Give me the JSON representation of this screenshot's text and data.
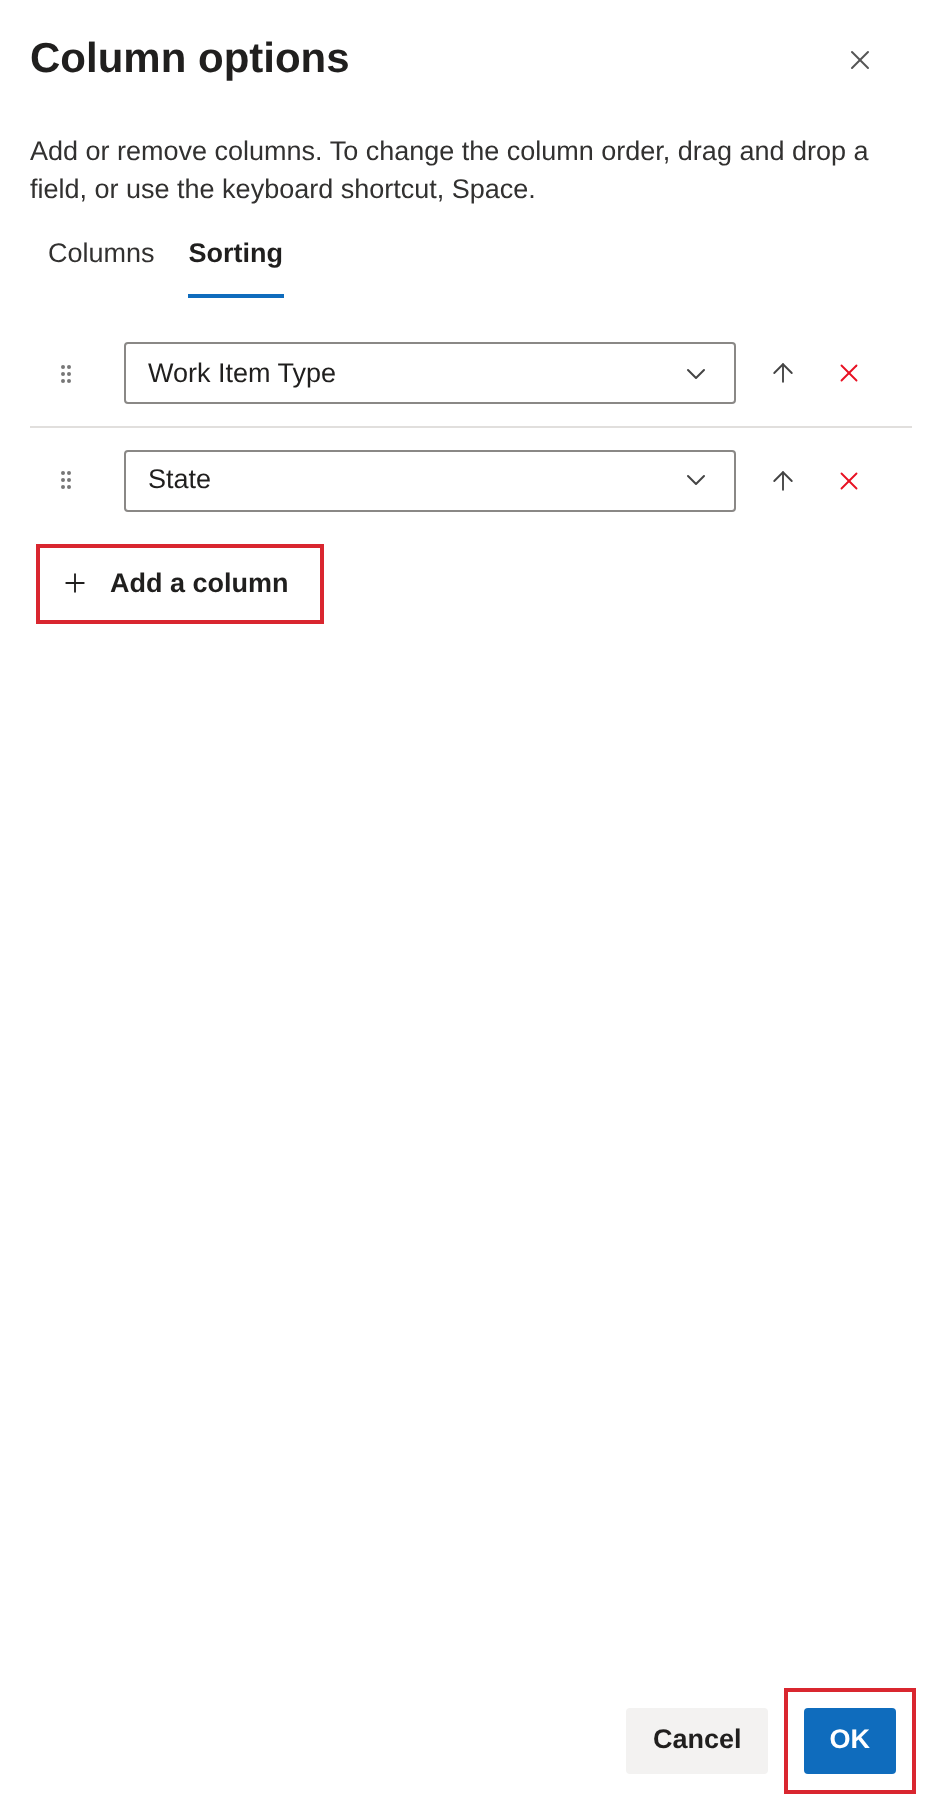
{
  "dialog": {
    "title": "Column options",
    "description": "Add or remove columns. To change the column order, drag and drop a field, or use the keyboard shortcut, Space."
  },
  "tabs": [
    {
      "label": "Columns",
      "selected": false
    },
    {
      "label": "Sorting",
      "selected": true
    }
  ],
  "sort_rows": [
    {
      "field": "Work Item Type"
    },
    {
      "field": "State"
    }
  ],
  "add_column": {
    "label": "Add a column",
    "highlighted": true
  },
  "buttons": [
    {
      "label": "Cancel",
      "kind": "secondary",
      "highlighted": false
    },
    {
      "label": "OK",
      "kind": "primary",
      "highlighted": true
    }
  ]
}
